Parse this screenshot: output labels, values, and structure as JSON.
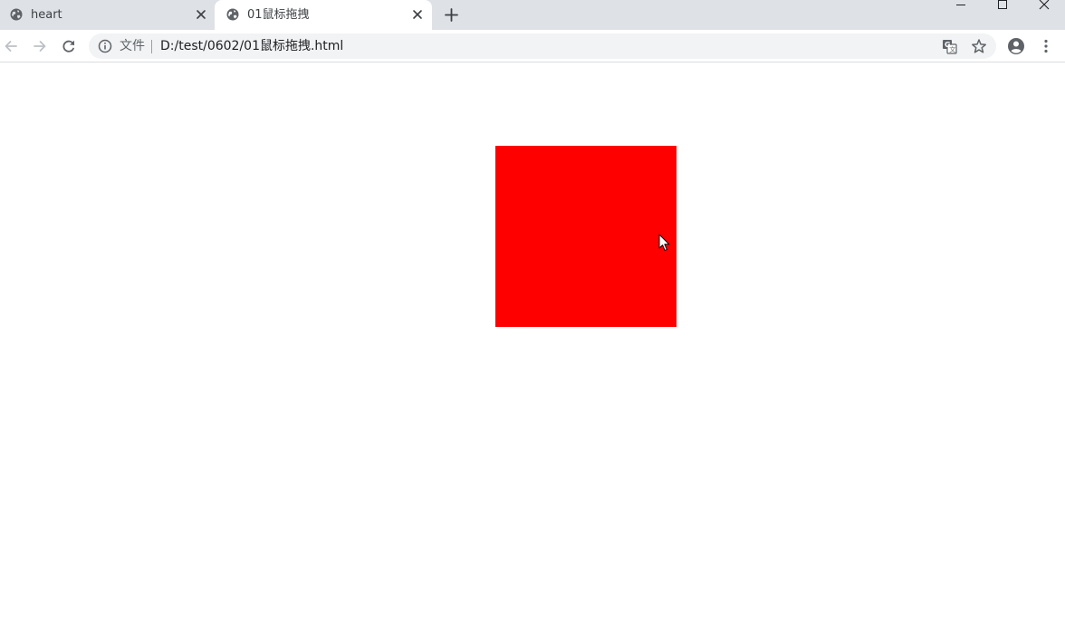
{
  "tabs": [
    {
      "title": "heart",
      "active": false,
      "icon": "globe-icon"
    },
    {
      "title": "01鼠标拖拽",
      "active": true,
      "icon": "globe-icon"
    }
  ],
  "omnibox": {
    "scheme_label": "文件",
    "url": "D:/test/0602/01鼠标拖拽.html"
  },
  "page": {
    "box_color": "#ff0000"
  },
  "colors": {
    "tabstrip": "#dee1e6",
    "active_tab": "#ffffff",
    "icon": "#5f6368"
  }
}
